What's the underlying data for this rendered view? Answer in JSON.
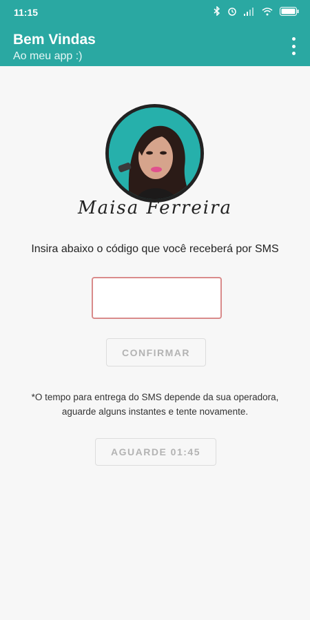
{
  "status_bar": {
    "time": "11:15",
    "icons": [
      "bluetooth-icon",
      "alarm-icon",
      "signal-icon",
      "wifi-icon",
      "battery-icon"
    ]
  },
  "app_bar": {
    "title": "Bem Vindas",
    "subtitle": "Ao meu app :)",
    "menu_icon": "more-vert-icon",
    "background": "#2aa8a2"
  },
  "profile": {
    "name_signature": "Maisa Ferreira"
  },
  "verification": {
    "instruction": "Insira abaixo o código que você receberá por SMS",
    "code_value": "",
    "confirm_label": "CONFIRMAR",
    "note": "*O tempo para entrega do SMS depende da sua operadora, aguarde alguns instantes e tente novamente.",
    "wait_label": "AGUARDE 01:45"
  }
}
